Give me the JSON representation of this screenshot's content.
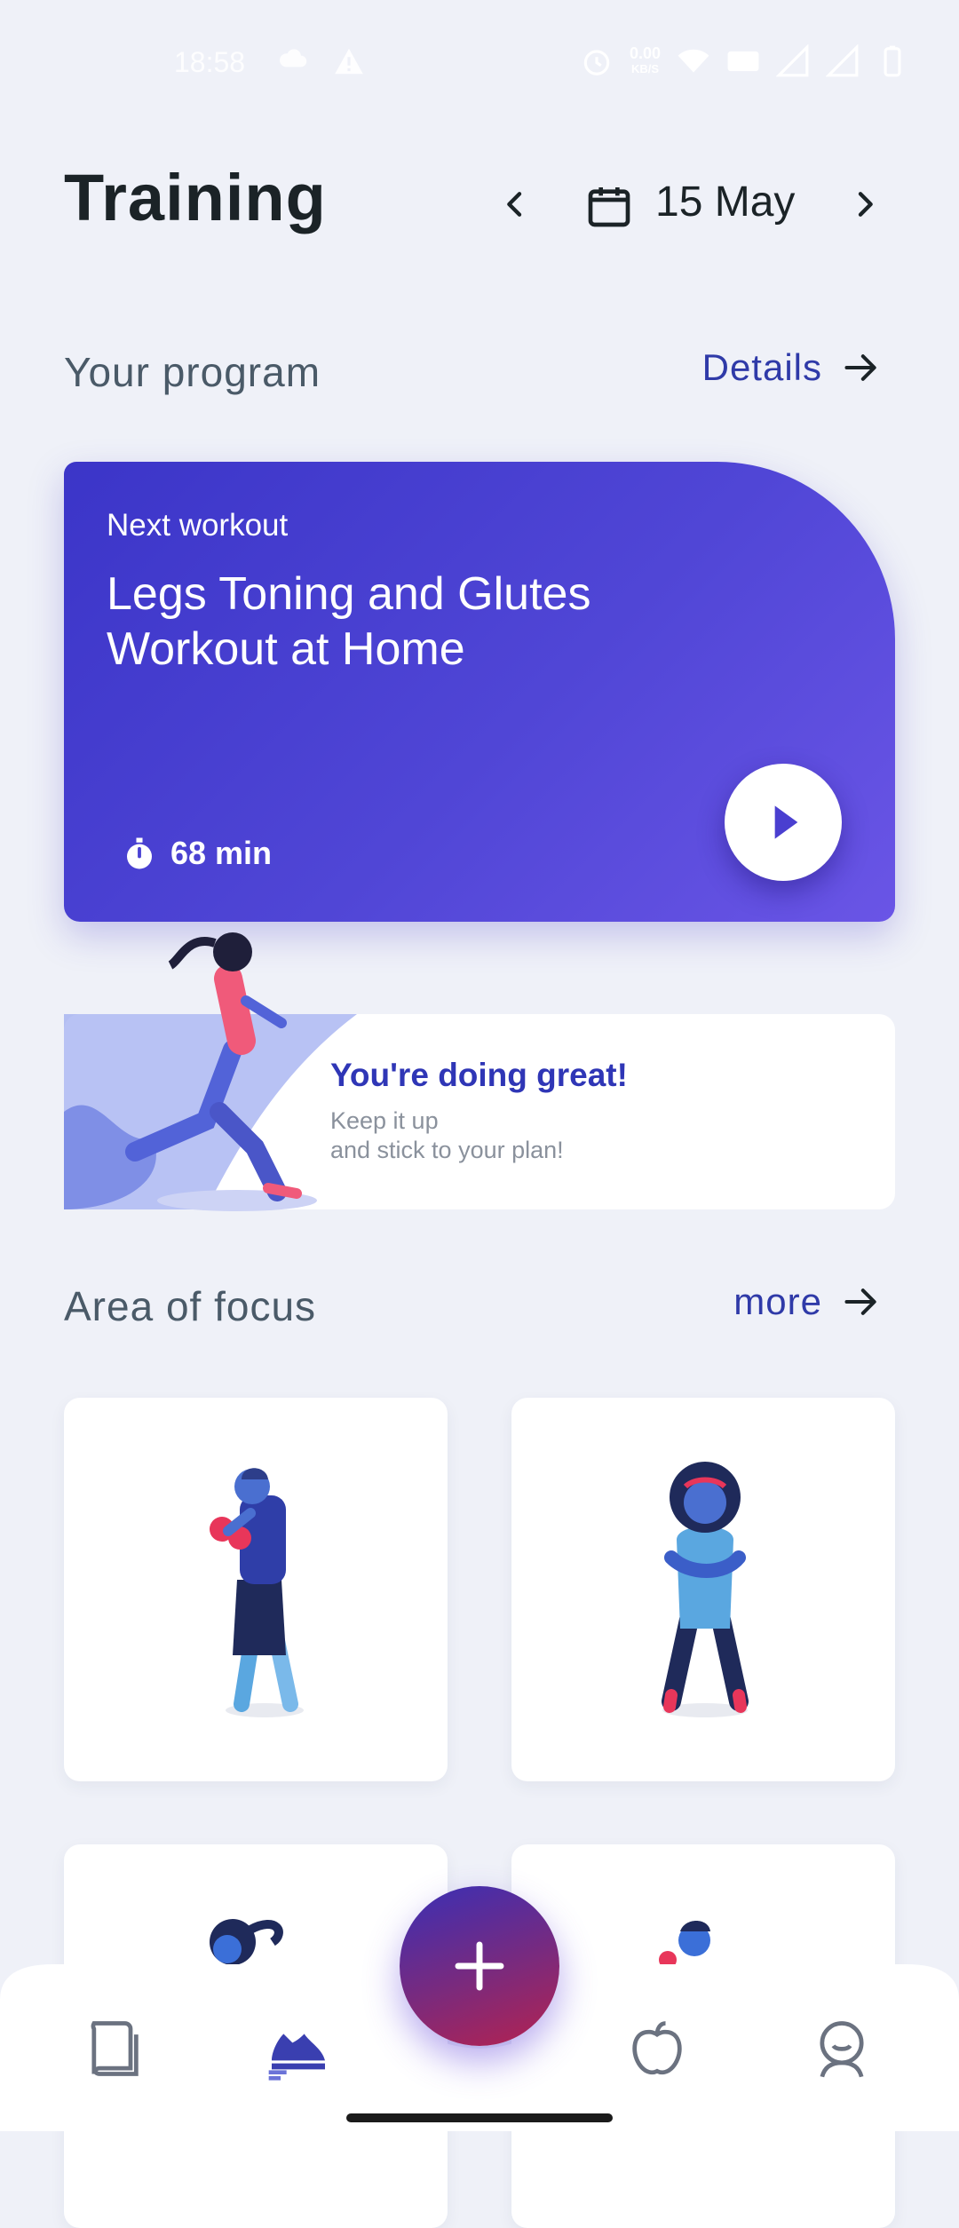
{
  "status_bar": {
    "time": "18:58",
    "net_speed_value": "0.00",
    "net_speed_unit": "KB/S",
    "icons": [
      "cloud-gamepad-icon",
      "warning-icon",
      "alarm-icon",
      "wifi-icon",
      "volte-icon",
      "signal-icon",
      "signal-icon-2",
      "battery-icon"
    ]
  },
  "header": {
    "title": "Training",
    "date": "15 May"
  },
  "program_section": {
    "title": "Your program",
    "link_label": "Details"
  },
  "workout_card": {
    "kicker": "Next workout",
    "title": "Legs Toning and Glutes Workout at Home",
    "duration": "68 min",
    "colors": {
      "start": "#3b35c8",
      "end": "#6a55e6"
    }
  },
  "motivation_card": {
    "title": "You're doing great!",
    "line1": "Keep it up",
    "line2": "and stick to your plan!"
  },
  "focus_section": {
    "title": "Area of focus",
    "link_label": "more"
  },
  "focus_cards": [
    "boxing-figure",
    "woman-figure",
    "ponytail-figure",
    "man-figure"
  ],
  "bottom_nav": {
    "items": [
      "book-icon",
      "sneaker-icon",
      "apple-icon",
      "profile-icon"
    ],
    "active": "sneaker-icon",
    "fab_icon": "plus-icon"
  },
  "colors": {
    "accent": "#2f3aa8",
    "background": "#eff1f8",
    "heading": "#1b2327"
  }
}
